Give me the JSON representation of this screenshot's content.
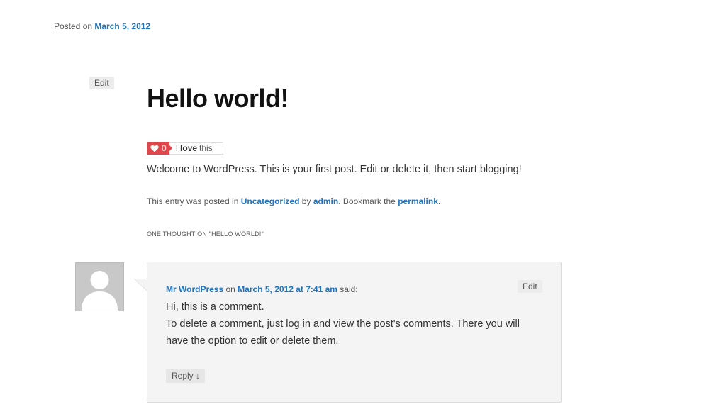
{
  "post": {
    "posted_prefix": "Posted on",
    "posted_date": "March 5, 2012",
    "edit_label": "Edit",
    "title": "Hello world!",
    "love": {
      "count": "0",
      "pre": "I",
      "bold": "love",
      "post": "this"
    },
    "content": "Welcome to WordPress. This is your first post. Edit or delete it, then start blogging!",
    "meta": {
      "prefix": "This entry was posted in",
      "category": "Uncategorized",
      "by": "by",
      "author": "admin",
      "bookmark": ". Bookmark the",
      "permalink": "permalink",
      "end": "."
    }
  },
  "comments": {
    "heading": "One thought on \"Hello world!\"",
    "items": [
      {
        "author": "Mr WordPress",
        "on": "on",
        "date": "March 5, 2012 at 7:41 am",
        "said": "said:",
        "edit_label": "Edit",
        "line1": "Hi, this is a comment.",
        "line2": "To delete a comment, just log in and view the post's comments. There you will have the option to edit or delete them.",
        "reply_label": "Reply ↓"
      }
    ]
  },
  "colors": {
    "link": "#1e73be",
    "love_badge": "#e0474c",
    "comment_bg": "#f4f4f4"
  }
}
